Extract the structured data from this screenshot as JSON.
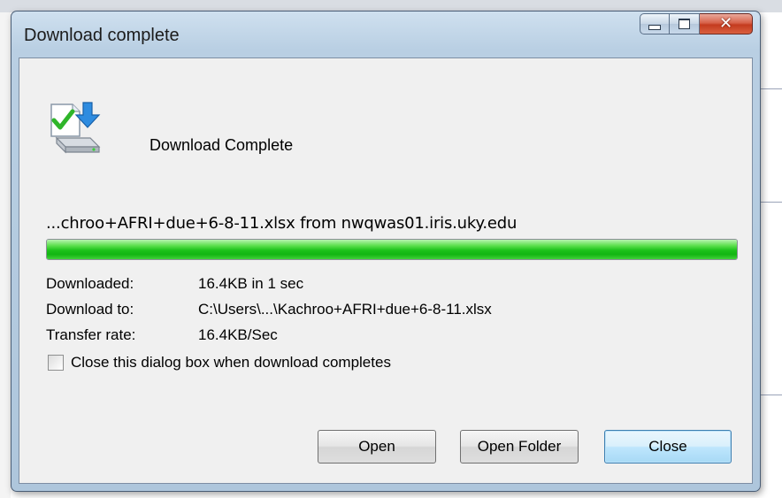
{
  "window": {
    "title": "Download complete"
  },
  "status": {
    "title": "Download Complete",
    "icon": "download-complete-icon"
  },
  "download": {
    "file_line": "...chroo+AFRI+due+6-8-11.xlsx from nwqwas01.iris.uky.edu",
    "progress_percent": 100
  },
  "details": [
    {
      "label": "Downloaded:",
      "value": "16.4KB in 1 sec"
    },
    {
      "label": "Download to:",
      "value": "C:\\Users\\...\\Kachroo+AFRI+due+6-8-11.xlsx"
    },
    {
      "label": "Transfer rate:",
      "value": "16.4KB/Sec"
    }
  ],
  "close_when_done": {
    "label": "Close this dialog box when download completes",
    "checked": false
  },
  "buttons": {
    "open": "Open",
    "open_folder": "Open Folder",
    "close": "Close"
  },
  "colors": {
    "progress_fill": "#1cc21a",
    "close_caption": "#c43b1f",
    "default_button": "#bee6fd"
  }
}
